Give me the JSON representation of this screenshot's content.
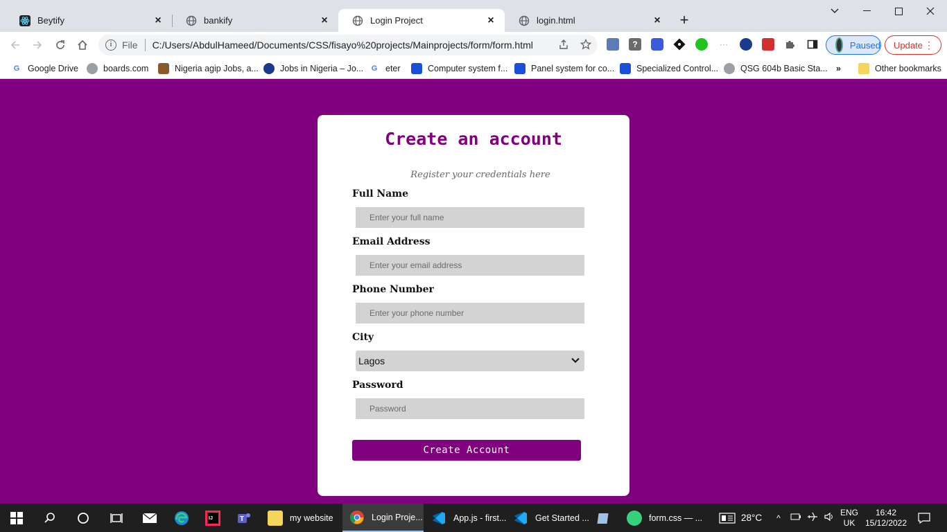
{
  "browser": {
    "tabs": [
      {
        "title": "Beytify",
        "icon": "react-icon",
        "active": false
      },
      {
        "title": "bankify",
        "icon": "globe-icon",
        "active": false
      },
      {
        "title": "Login Project",
        "icon": "globe-icon",
        "active": true
      },
      {
        "title": "login.html",
        "icon": "globe-icon",
        "active": false
      }
    ],
    "new_tab": "+",
    "address": {
      "scheme_label": "File",
      "url": "C:/Users/AbdulHameed/Documents/CSS/fisayo%20projects/Mainprojects/form/form.html"
    },
    "profile_label": "Paused",
    "update_label": "Update",
    "bookmarks": [
      {
        "label": "Google Drive",
        "icon": "google-icon"
      },
      {
        "label": "boards.com",
        "icon": "globe-icon"
      },
      {
        "label": "Nigeria agip Jobs, a...",
        "icon": "jobs-icon"
      },
      {
        "label": "Jobs in Nigeria – Jo...",
        "icon": "jobs-icon"
      },
      {
        "label": "eter",
        "icon": "google-icon"
      },
      {
        "label": "Computer system f...",
        "icon": "doc-icon"
      },
      {
        "label": "Panel system for co...",
        "icon": "doc-icon"
      },
      {
        "label": "Specialized Control...",
        "icon": "doc-icon"
      },
      {
        "label": "QSG 604b Basic Sta...",
        "icon": "globe-icon"
      }
    ],
    "bookmarks_overflow": "»",
    "other_bookmarks": "Other bookmarks"
  },
  "form": {
    "title": "Create an account",
    "subtitle": "Register your credentials here",
    "full_name_label": "Full Name",
    "full_name_placeholder": "Enter your full name",
    "email_label": "Email Address",
    "email_placeholder": "Enter your email address",
    "phone_label": "Phone Number",
    "phone_placeholder": "Enter your phone number",
    "city_label": "City",
    "city_value": "Lagos",
    "password_label": "Password",
    "password_placeholder": "Password",
    "submit_label": "Create Account"
  },
  "colors": {
    "brand": "#800080",
    "field_bg": "#d3d3d3"
  },
  "taskbar": {
    "apps": [
      {
        "label": "my website",
        "icon": "folder-icon",
        "active": false
      },
      {
        "label": "Login Proje...",
        "icon": "chrome-icon",
        "active": true
      },
      {
        "label": "App.js - first...",
        "icon": "vscode-icon",
        "active": false
      },
      {
        "label": "Get Started ...",
        "icon": "vscode-icon",
        "active": false
      },
      {
        "label": "form.css — ...",
        "icon": "atom-icon",
        "active": false
      }
    ],
    "weather": "28°C",
    "language_top": "ENG",
    "language_bottom": "UK",
    "time": "16:42",
    "date": "15/12/2022"
  }
}
